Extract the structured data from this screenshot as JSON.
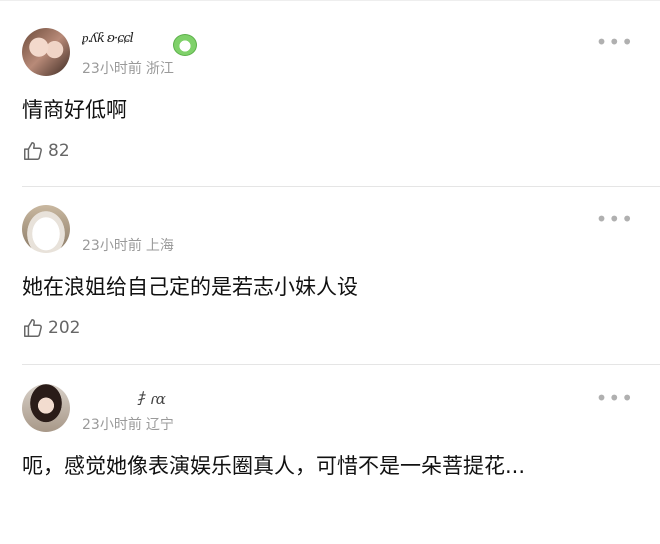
{
  "comments": [
    {
      "username": "ᵱ.ʎƙ ʚ·ɕɕl",
      "has_badge": true,
      "time": "23小时前",
      "location": "浙江",
      "text": "情商好低啊",
      "likes": "82"
    },
    {
      "username": "",
      "has_badge": false,
      "time": "23小时前",
      "location": "上海",
      "text": "她在浪姐给自己定的是若志小妹人设",
      "likes": "202"
    },
    {
      "username": "扌ɾɑ",
      "has_badge": false,
      "time": "23小时前",
      "location": "辽宁",
      "text": "呃，感觉她像表演娱乐圈真人，可惜不是一朵菩提花...",
      "likes": ""
    }
  ],
  "icons": {
    "more": "more-dots-icon",
    "like": "thumbs-up-icon",
    "badge": "green-badge-icon"
  },
  "colors": {
    "meta": "#9a9a9a",
    "text": "#111111",
    "divider": "#e5e5e5",
    "badge": "#7fd16a"
  }
}
